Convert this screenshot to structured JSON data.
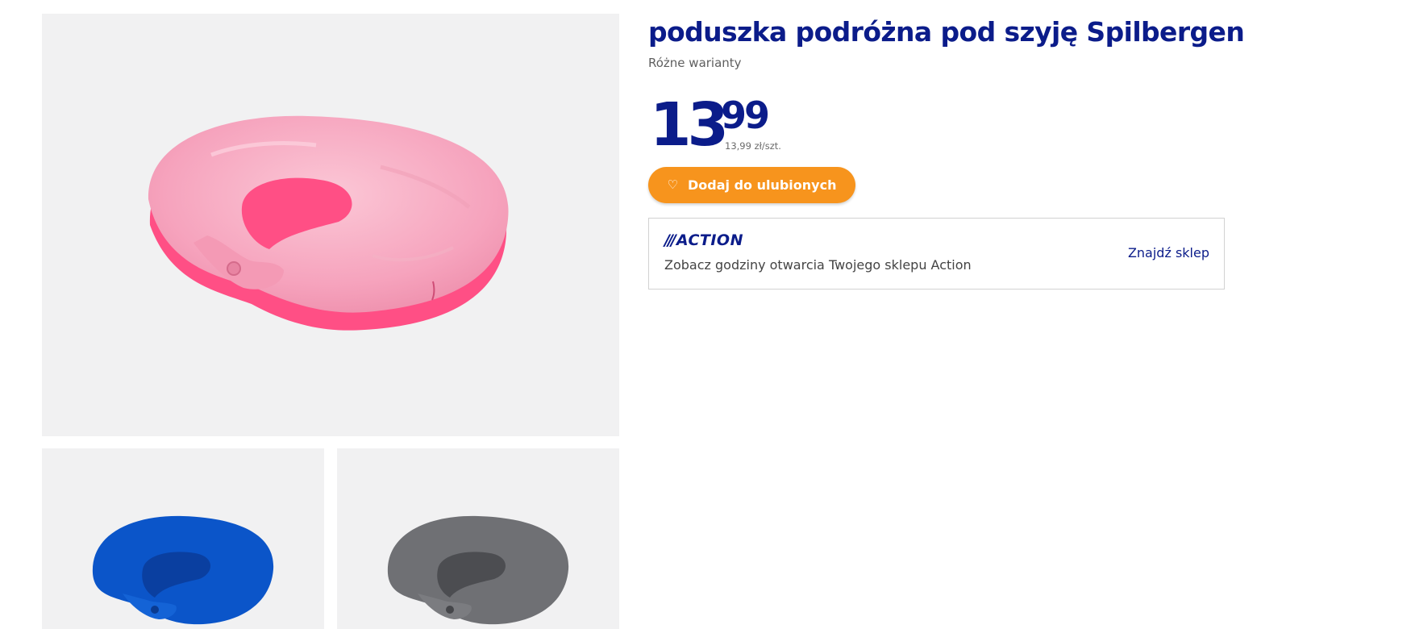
{
  "product": {
    "title": "poduszka podróżna pod szyję Spilbergen",
    "variants": "Różne warianty",
    "price_int": "13",
    "price_dec": "99",
    "unit_price": "13,99 zł/szt."
  },
  "actions": {
    "favorite_label": "Dodaj do ulubionych",
    "favorite_icon": "heart-icon"
  },
  "store": {
    "logo_slashes": "///",
    "logo_text": "ACTION",
    "opening_hours_text": "Zobacz godziny otwarcia Twojego sklepu Action",
    "find_store_label": "Znajdź sklep"
  },
  "gallery": {
    "main_variant": "pink",
    "thumbnails": [
      "blue",
      "grey"
    ]
  },
  "colors": {
    "brand_blue": "#0b1c8a",
    "button_orange": "#f7941d",
    "photo_background": "#f1f1f2",
    "pillow_pink": "#f6a9c0",
    "pillow_pink_inner": "#ff4f85",
    "pillow_blue": "#0b55c9",
    "pillow_grey": "#6f7074"
  }
}
